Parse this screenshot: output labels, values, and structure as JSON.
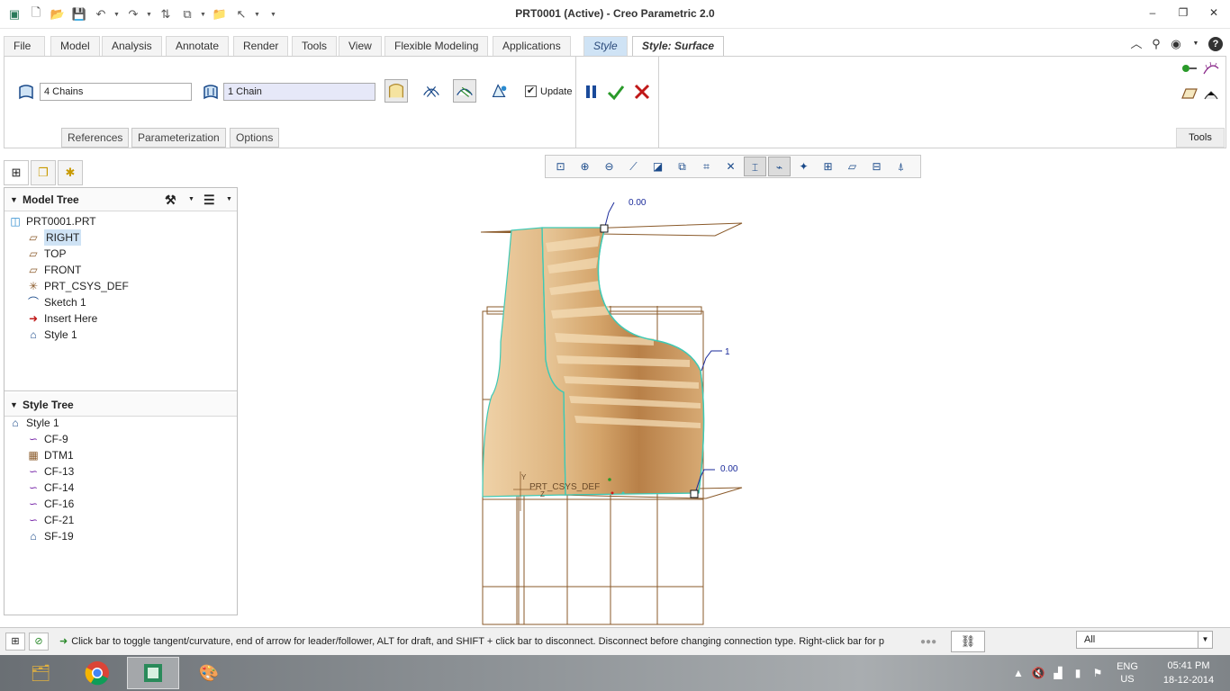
{
  "window": {
    "title": "PRT0001 (Active) - Creo Parametric 2.0",
    "qat_icons": [
      "app-icon",
      "new-icon",
      "open-icon",
      "save-icon",
      "undo-icon",
      "redo-icon",
      "regenerate-icon",
      "windows-icon",
      "folder-icon",
      "select-icon"
    ],
    "controls": [
      "minimize-icon",
      "restore-icon",
      "close-icon"
    ]
  },
  "ribbon": {
    "tabs": [
      "File",
      "Model",
      "Analysis",
      "Annotate",
      "Render",
      "Tools",
      "View",
      "Flexible Modeling",
      "Applications",
      "Style",
      "Style: Surface"
    ],
    "active_tab": "Style: Surface",
    "chains_field": "4 Chains",
    "chain_field": "1 Chain",
    "update_label": "Update",
    "update_checked": true,
    "subtabs": [
      "References",
      "Parameterization",
      "Options"
    ],
    "tools_label": "Tools"
  },
  "model_tree": {
    "title": "Model Tree",
    "root": "PRT0001.PRT",
    "items": [
      {
        "label": "RIGHT",
        "icon": "datum-plane-icon",
        "selected": true
      },
      {
        "label": "TOP",
        "icon": "datum-plane-icon",
        "selected": false
      },
      {
        "label": "FRONT",
        "icon": "datum-plane-icon",
        "selected": false
      },
      {
        "label": "PRT_CSYS_DEF",
        "icon": "csys-icon",
        "selected": false
      },
      {
        "label": "Sketch 1",
        "icon": "sketch-icon",
        "selected": false
      },
      {
        "label": "Insert Here",
        "icon": "insert-arrow-icon",
        "selected": false
      },
      {
        "label": "Style 1",
        "icon": "style-feature-icon",
        "selected": false
      }
    ]
  },
  "style_tree": {
    "title": "Style Tree",
    "root": "Style 1",
    "items": [
      "CF-9",
      "DTM1",
      "CF-13",
      "CF-14",
      "CF-16",
      "CF-21",
      "SF-19"
    ]
  },
  "viewport": {
    "dim_top": "0.00",
    "dim_mid": "1",
    "dim_bottom": "0.00",
    "csys_label": "PRT_CSYS_DEF",
    "axis_y": "Y",
    "axis_z": "Z"
  },
  "status": {
    "message": "Click bar to toggle tangent/curvature, end of arrow for leader/follower, ALT for draft, and SHIFT + click bar to disconnect. Disconnect before changing connection type.  Right-click bar for p",
    "filter": "All"
  },
  "taskbar": {
    "lang_top": "ENG",
    "lang_bottom": "US",
    "time": "05:41 PM",
    "date": "18-12-2014"
  },
  "colors": {
    "surface": "#d8a76b",
    "surface_dark": "#a97840",
    "curve_edge": "#3fc9b4",
    "datum": "#8a5a2a",
    "dimension": "#1a2a9a",
    "accent_tab": "#cfe3f5"
  }
}
